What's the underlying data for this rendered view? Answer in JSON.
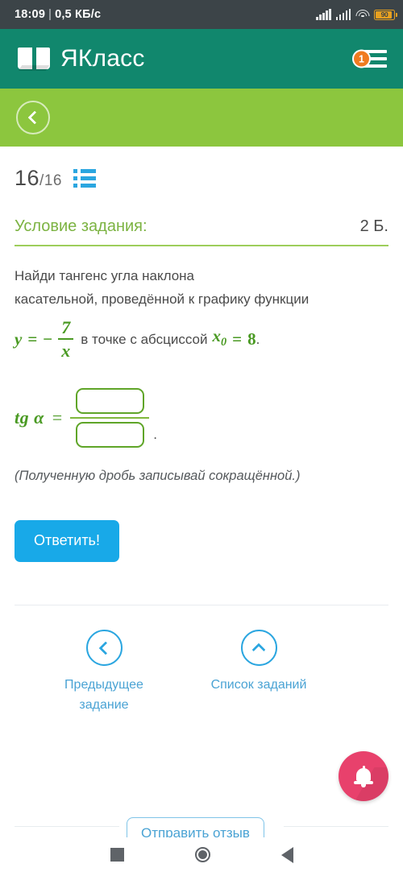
{
  "status_bar": {
    "time": "18:09",
    "separator": "|",
    "data_rate": "0,5 КБ/с",
    "battery_level": "90",
    "icons": [
      "signal-bars-icon",
      "signal-bars-icon",
      "wifi-icon",
      "battery-icon"
    ]
  },
  "app_header": {
    "brand": "ЯКласс",
    "logo_icon": "open-book-icon",
    "notification_count": "1",
    "menu_icon": "hamburger-menu-icon",
    "background_color": "#11876d"
  },
  "sub_header": {
    "back_icon": "chevron-left-icon",
    "background_color": "#8cc63e"
  },
  "progress": {
    "current": "16",
    "total": "/16",
    "list_icon": "task-list-icon"
  },
  "task": {
    "title": "Условие задания:",
    "points": "2 Б.",
    "question_line_1": "Найди тангенс угла наклона",
    "question_line_2": "касательной, проведённой к графику функции",
    "formula": {
      "y": "y",
      "equals": "=",
      "minus": "−",
      "numerator": "7",
      "denominator": "x",
      "mid_text": "в точке с абсциссой",
      "x0": "x",
      "x0_sub": "0",
      "equals2": "=",
      "value": "8",
      "period": "."
    },
    "answer": {
      "label": "tg α",
      "equals": "=",
      "numerator_value": "",
      "denominator_value": "",
      "trailing_period": "."
    },
    "hint": "(Полученную дробь записывай сокращённой.)",
    "submit_label": "Ответить!",
    "submit_color": "#18a9e8"
  },
  "navigation": {
    "previous": {
      "label_line_1": "Предыдущее",
      "label_line_2": "задание",
      "icon": "chevron-left-circle-icon"
    },
    "list": {
      "label_line_1": "Список заданий",
      "label_line_2": "",
      "icon": "chevron-up-circle-icon"
    }
  },
  "feedback": {
    "label": "Отправить отзыв"
  },
  "fab": {
    "icon": "bell-icon",
    "color": "#e8416c"
  },
  "system_nav": {
    "recents_icon": "square-recents-icon",
    "home_icon": "circle-home-icon",
    "back_icon": "triangle-back-icon"
  }
}
